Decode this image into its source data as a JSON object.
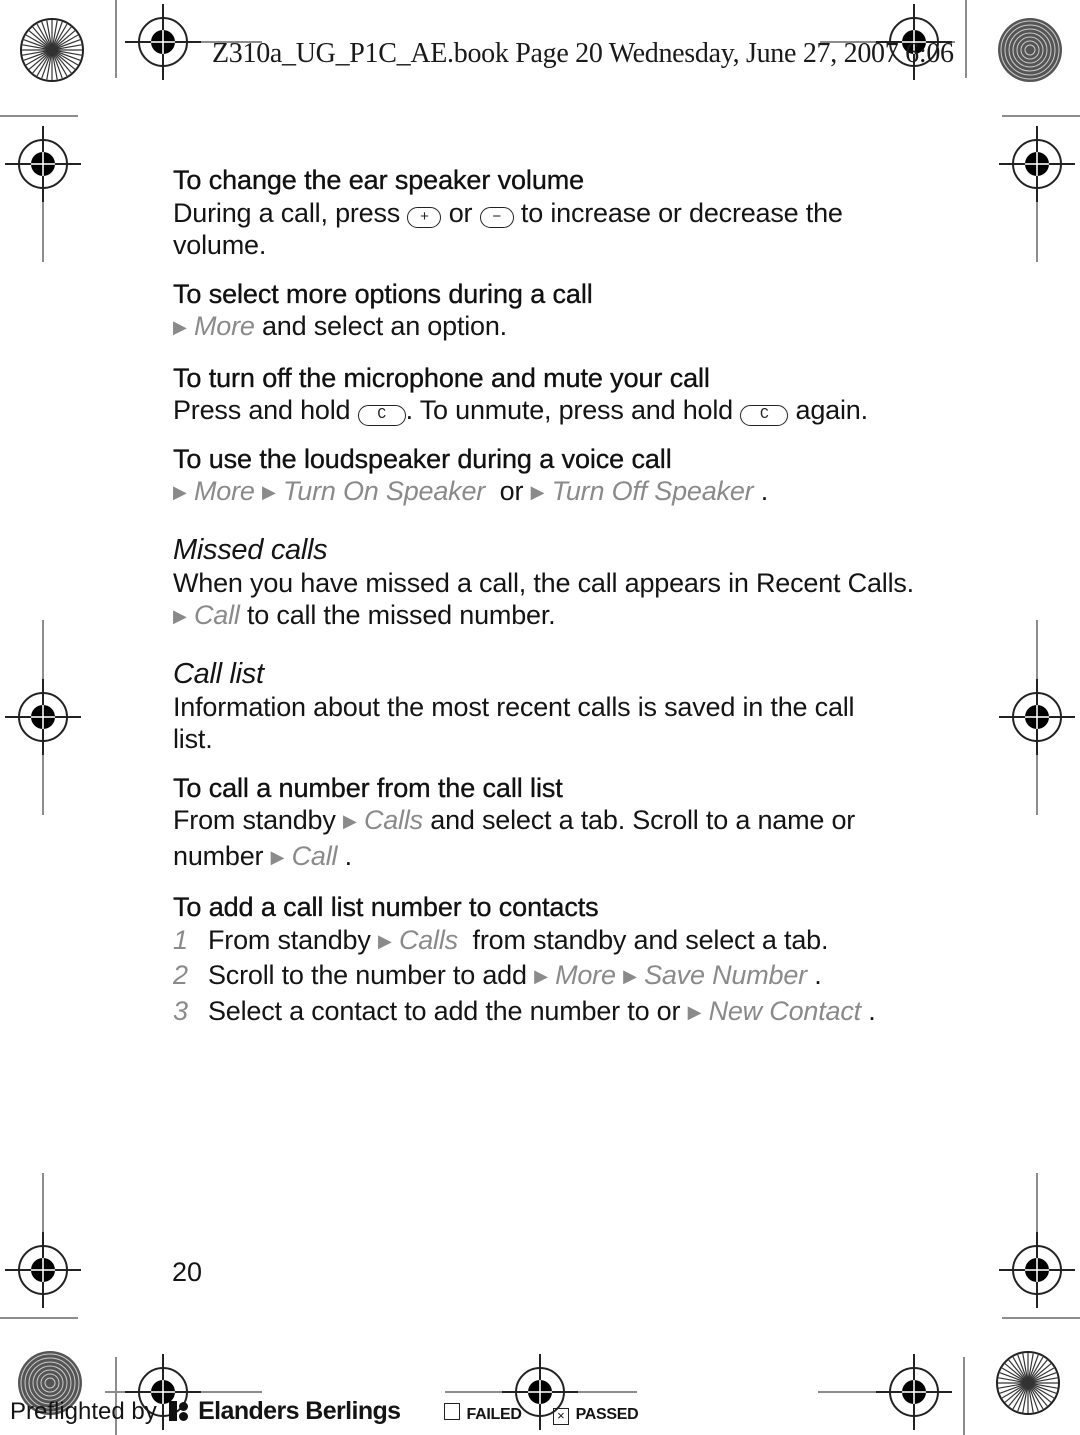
{
  "header": {
    "slug": "Z310a_UG_P1C_AE.book  Page 20  Wednesday, June 27, 2007  6:06"
  },
  "sections": {
    "ear_volume": {
      "heading": "To change the ear speaker volume",
      "text_before": "During a call, press ",
      "key1": "+",
      "text_mid": " or ",
      "key2": "−",
      "text_after": " to increase or decrease the volume."
    },
    "more_options": {
      "heading": "To select more options during a call",
      "menu1": "More",
      "text_after": " and select an option."
    },
    "mute": {
      "heading": "To turn off the microphone and mute your call",
      "text_before": "Press and hold ",
      "key": "C",
      "text_mid": ". To unmute, press and hold ",
      "text_after": " again."
    },
    "loudspeaker": {
      "heading": "To use the loudspeaker during a voice call",
      "menu1": "More",
      "menu2": "Turn On Speaker",
      "text_or": "  or ",
      "menu3": "Turn Off Speaker",
      "text_end": " ."
    },
    "missed_calls": {
      "title": "Missed calls",
      "text_before": "When you have missed a call, the call appears in Recent Calls. ",
      "menu1": "Call",
      "text_after": " to call the missed number."
    },
    "call_list": {
      "title": "Call list",
      "text": "Information about the most recent calls is saved in the call list."
    },
    "call_from_list": {
      "heading": "To call a number from the call list",
      "text_before": "From standby ",
      "menu1": "Calls",
      "text_mid": "  and select a tab. Scroll to a name or number ",
      "menu2": "Call",
      "text_end": " ."
    },
    "add_to_contacts": {
      "heading": "To add a call list number to contacts",
      "steps": [
        {
          "num": "1",
          "text_before": "From standby ",
          "menu1": "Calls",
          "text_after": "  from standby and select a tab."
        },
        {
          "num": "2",
          "text_before": "Scroll to the number to add ",
          "menu1": "More",
          "menu2": "Save Number",
          "text_after": " ."
        },
        {
          "num": "3",
          "text_before": "Select a contact to add the number to or ",
          "menu1": "New Contact",
          "text_after": " ."
        }
      ]
    }
  },
  "page_number": "20",
  "footer": {
    "preflight_label": "Preflighted by",
    "brand": "Elanders Berlings",
    "failed_label": "FAILED",
    "failed_checked": false,
    "passed_label": "PASSED",
    "passed_checked": true,
    "check_mark": "×"
  },
  "icons": {
    "arrow": "▶"
  },
  "colors": {
    "text": "#141414",
    "menu_gray": "#8a8a8a",
    "crop_mark": "#8c8c8c"
  }
}
